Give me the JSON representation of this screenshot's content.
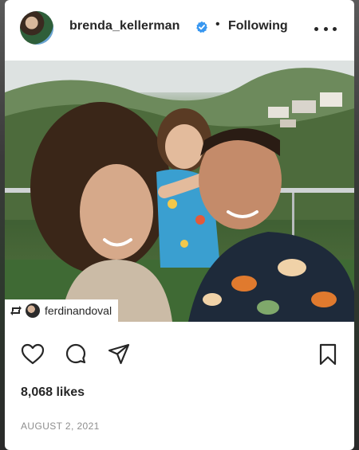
{
  "post": {
    "username": "brenda_kellerman",
    "verified_icon": "verified-badge-icon",
    "separator": "•",
    "follow_status": "Following",
    "more_icon": "more-options-icon",
    "photo_alt": "Post photo",
    "repost": {
      "icon": "repost-icon",
      "original_user": "ferdinandoval"
    },
    "tag_icon": "user-tag-icon",
    "actions": {
      "like_icon": "heart-icon",
      "comment_icon": "comment-icon",
      "share_icon": "send-icon",
      "save_icon": "bookmark-icon"
    },
    "likes": "8,068 likes",
    "date": "AUGUST 2, 2021"
  },
  "colors": {
    "text": "#262626",
    "muted": "#8e8e8e",
    "verified": "#3897f0"
  }
}
